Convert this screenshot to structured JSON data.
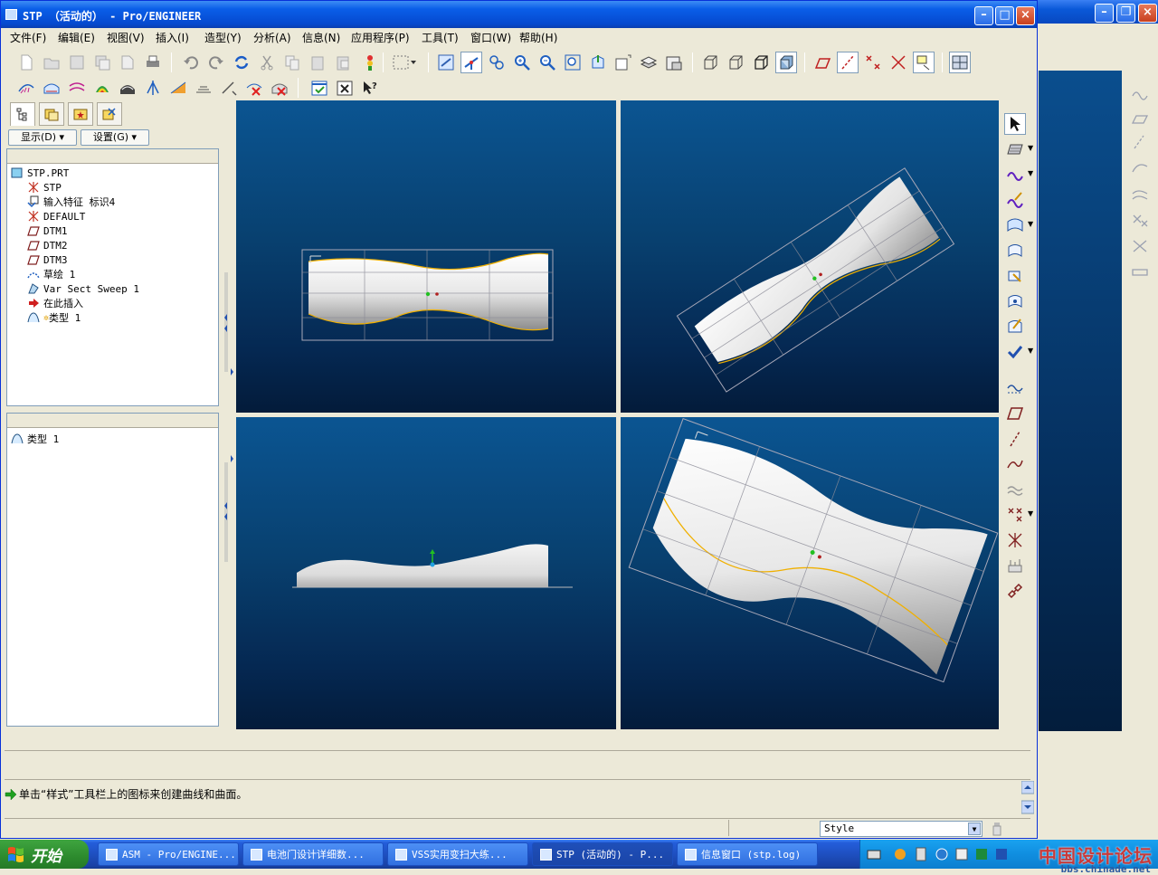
{
  "window": {
    "title": "STP （活动的） - Pro/ENGINEER"
  },
  "menu": [
    "文件(F)",
    "编辑(E)",
    "视图(V)",
    "插入(I)",
    "造型(Y)",
    "分析(A)",
    "信息(N)",
    "应用程序(P)",
    "工具(T)",
    "窗口(W)",
    "帮助(H)"
  ],
  "nav": {
    "show_label": "显示(D)",
    "settings_label": "设置(G)"
  },
  "tree": {
    "items": [
      {
        "label": "STP.PRT",
        "icon": "part-icon"
      },
      {
        "label": "STP",
        "icon": "coordinate-system-icon"
      },
      {
        "label": "输入特征 标识4",
        "icon": "import-feature-icon"
      },
      {
        "label": "DEFAULT",
        "icon": "coordinate-system-icon"
      },
      {
        "label": "DTM1",
        "icon": "datum-plane-icon"
      },
      {
        "label": "DTM2",
        "icon": "datum-plane-icon"
      },
      {
        "label": "DTM3",
        "icon": "datum-plane-icon"
      },
      {
        "label": "草绘 1",
        "icon": "sketch-icon"
      },
      {
        "label": "Var Sect Sweep 1",
        "icon": "sweep-icon"
      },
      {
        "label": "在此插入",
        "icon": "insert-here-arrow-icon"
      },
      {
        "label": "类型 1",
        "icon": "style-feature-icon"
      }
    ]
  },
  "style_tree": {
    "items": [
      {
        "label": "类型 1",
        "icon": "style-feature-icon"
      }
    ]
  },
  "message": "单击“样式”工具栏上的图标来创建曲线和曲面。",
  "status": {
    "filter_value": "Style"
  },
  "taskbar": {
    "start_label": "开始",
    "tasks": [
      {
        "label": "ASM - Pro/ENGINE...",
        "active": false
      },
      {
        "label": "电池门设计详细数...",
        "active": false
      },
      {
        "label": "VSS实用变扫大练...",
        "active": false
      },
      {
        "label": "STP (活动的) - P...",
        "active": true
      },
      {
        "label": "信息窗口 (stp.log)",
        "active": false
      }
    ],
    "watermark": "中国设计论坛",
    "watermark_url": "bbs.chinade.net"
  },
  "colors": {
    "titlebar": "#0a5ee8",
    "viewport_top": "#0b5592",
    "viewport_bottom": "#031b3a",
    "edge_curve": "#f0b000",
    "taskbar": "#245edb"
  }
}
